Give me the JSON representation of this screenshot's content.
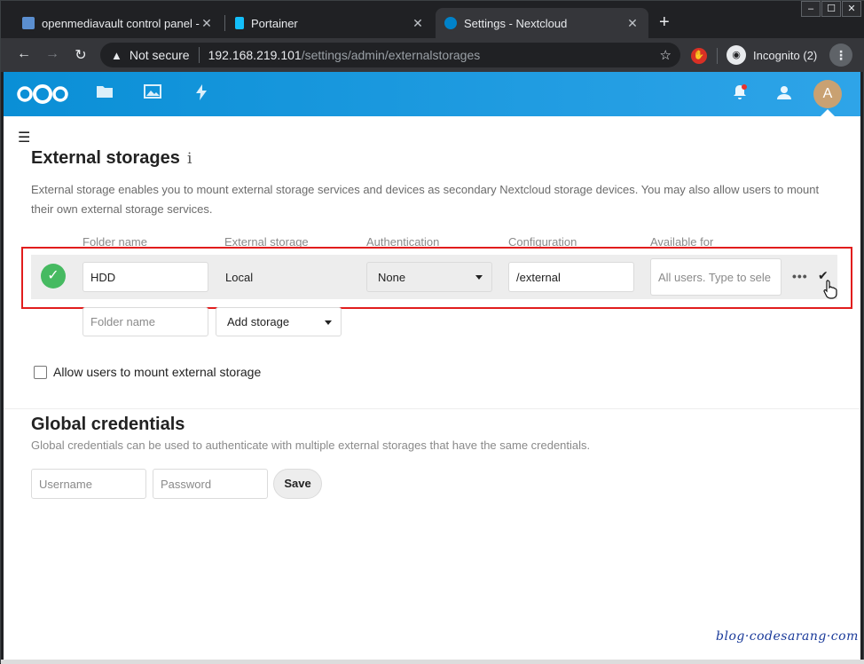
{
  "browser": {
    "tabs": [
      {
        "title": "openmediavault control panel - l",
        "active": false,
        "favicon_color": "#5b8fd0"
      },
      {
        "title": "Portainer",
        "active": false,
        "favicon_color": "#13bef9"
      },
      {
        "title": "Settings - Nextcloud",
        "active": true,
        "favicon_color": "#0082c9"
      }
    ],
    "new_tab": "+",
    "window_controls": [
      "–",
      "☐",
      "✕"
    ],
    "not_secure": "Not secure",
    "url_host": "192.168.219.101",
    "url_path": "/settings/admin/externalstorages",
    "incognito_label": "Incognito (2)"
  },
  "header": {
    "avatar_letter": "A",
    "brand_color": "#0082c9"
  },
  "external_storages": {
    "title": "External storages",
    "info_icon": "i",
    "description": "External storage enables you to mount external storage services and devices as secondary Nextcloud storage devices. You may also allow users to mount their own external storage services.",
    "columns": [
      "Folder name",
      "External storage",
      "Authentication",
      "Configuration",
      "Available for"
    ],
    "row": {
      "folder_name": "HDD",
      "storage": "Local",
      "authentication": "None",
      "configuration": "/external",
      "available_for_placeholder": "All users. Type to sele"
    },
    "new_row": {
      "folder_name_placeholder": "Folder name",
      "add_storage_label": "Add storage"
    },
    "allow_users_label": "Allow users to mount external storage"
  },
  "global_credentials": {
    "title": "Global credentials",
    "description": "Global credentials can be used to authenticate with multiple external storages that have the same credentials.",
    "username_placeholder": "Username",
    "password_placeholder": "Password",
    "save_label": "Save"
  },
  "watermark": "blog·codesarang·com"
}
